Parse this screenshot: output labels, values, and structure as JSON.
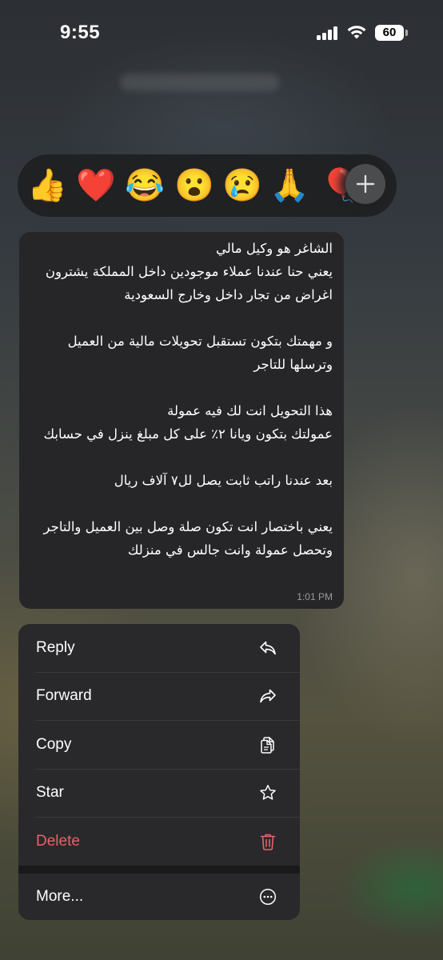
{
  "status_bar": {
    "time": "9:55",
    "battery": "60"
  },
  "reactions": {
    "emojis": [
      "👍",
      "❤️",
      "😂",
      "😮",
      "😢",
      "🙏",
      "🎈"
    ],
    "more_icon": "plus-icon"
  },
  "message": {
    "text": "الشاغر هو وكيل مالي\nيعني حنا عندنا عملاء موجودين داخل المملكة يشترون اغراض من تجار داخل وخارج السعودية\n\nو مهمتك بتكون تستقبل تحويلات مالية من العميل وترسلها للتاجر\n\nهذا التحويل انت لك فيه عمولة\nعمولتك بتكون ويانا ٢٪ على كل مبلغ ينزل في حسابك\n\nبعد عندنا راتب ثابت يصل لل٧ آلاف ريال\n\nيعني باختصار انت تكون صلة وصل بين العميل والتاجر وتحصل عمولة وانت جالس في منزلك",
    "time": "1:01 PM"
  },
  "menu": {
    "reply": "Reply",
    "forward": "Forward",
    "copy": "Copy",
    "star": "Star",
    "delete": "Delete",
    "more": "More..."
  },
  "colors": {
    "delete": "#e8616b",
    "bubble": "#262628",
    "menu": "#29292b"
  }
}
